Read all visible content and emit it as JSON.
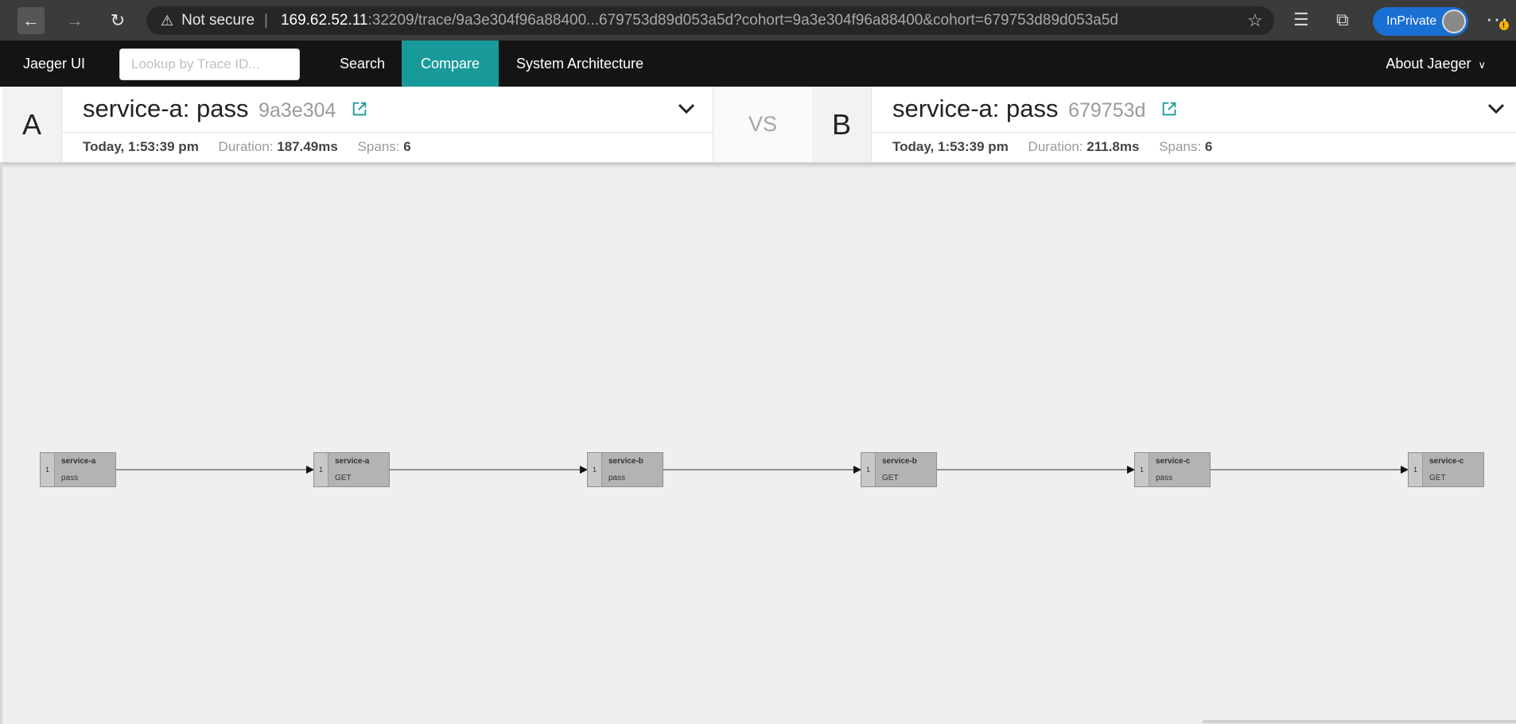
{
  "browser": {
    "security_label": "Not secure",
    "url_host": "169.62.52.11",
    "url_rest": ":32209/trace/9a3e304f96a88400...679753d89d053a5d?cohort=9a3e304f96a88400&cohort=679753d89d053a5d",
    "inprivate_label": "InPrivate"
  },
  "topnav": {
    "brand": "Jaeger UI",
    "lookup_placeholder": "Lookup by Trace ID...",
    "items": [
      "Search",
      "Compare",
      "System Architecture"
    ],
    "active_item": "Compare",
    "about": "About Jaeger"
  },
  "compare": {
    "vs_label": "VS",
    "a": {
      "letter": "A",
      "title": "service-a: pass",
      "trace_id": "9a3e304",
      "date": "Today, 1:53:39 pm",
      "duration_label": "Duration:",
      "duration": "187.49ms",
      "spans_label": "Spans:",
      "spans": "6"
    },
    "b": {
      "letter": "B",
      "title": "service-a: pass",
      "trace_id": "679753d",
      "date": "Today, 1:53:39 pm",
      "duration_label": "Duration:",
      "duration": "211.8ms",
      "spans_label": "Spans:",
      "spans": "6"
    }
  },
  "graph": {
    "nodes": [
      {
        "count": "1",
        "service": "service-a",
        "operation": "pass"
      },
      {
        "count": "1",
        "service": "service-a",
        "operation": "GET"
      },
      {
        "count": "1",
        "service": "service-b",
        "operation": "pass"
      },
      {
        "count": "1",
        "service": "service-b",
        "operation": "GET"
      },
      {
        "count": "1",
        "service": "service-c",
        "operation": "pass"
      },
      {
        "count": "1",
        "service": "service-c",
        "operation": "GET"
      }
    ]
  },
  "colors": {
    "accent": "#199a9a",
    "node_fill": "#b3b3b3",
    "nav_bg": "#141414"
  }
}
